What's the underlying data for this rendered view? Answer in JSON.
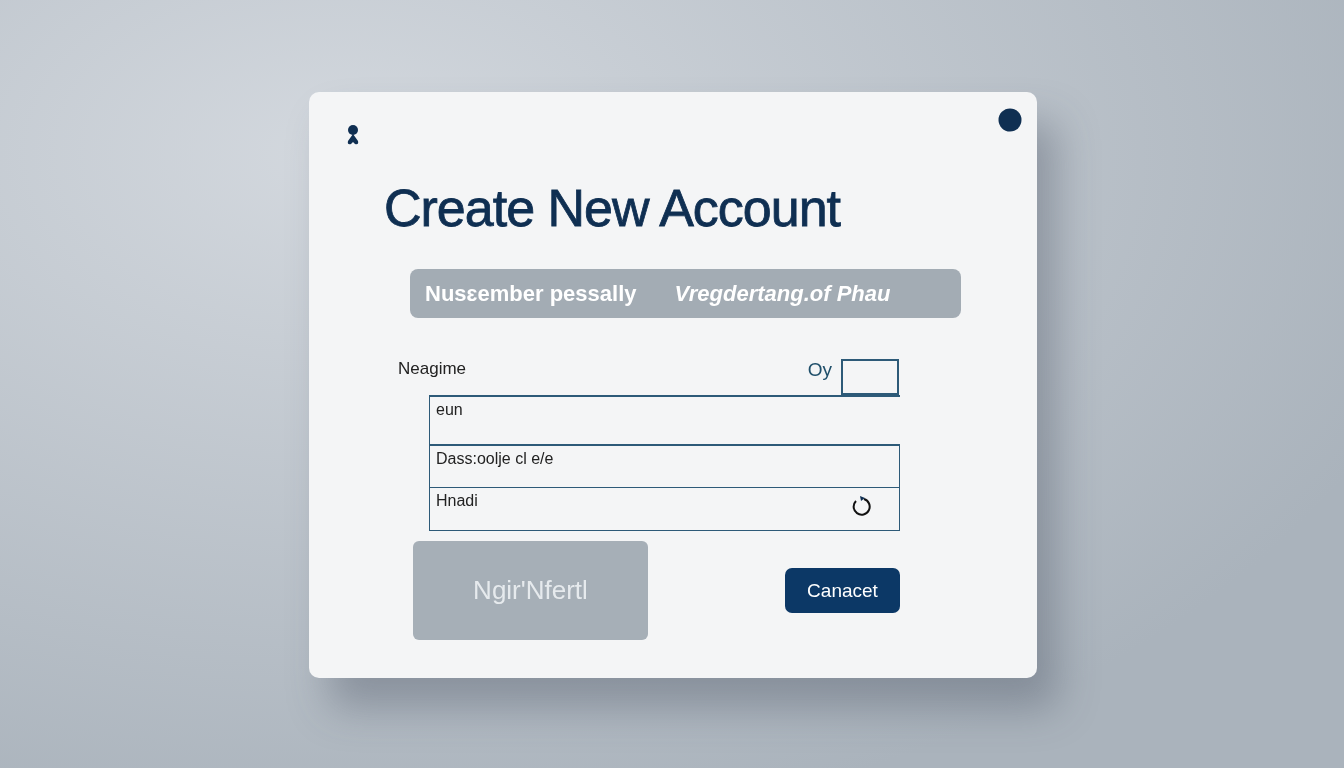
{
  "dialog": {
    "title": "Create New Account",
    "banner": {
      "left": "Nusɛember  pessally",
      "right": "Vregdertang.of Phau"
    },
    "name_row": {
      "label": "Neagime",
      "hint": "Oy"
    },
    "fields": [
      {
        "kind": "open",
        "value": "eun"
      },
      {
        "kind": "text",
        "value": "Dass:oolje cl e/e"
      },
      {
        "kind": "loading",
        "value": "Hnadi"
      }
    ],
    "buttons": [
      {
        "label": "Ngir'Nfertl",
        "kind": "secondary"
      },
      {
        "label": "Canacet",
        "kind": "primary"
      }
    ]
  }
}
